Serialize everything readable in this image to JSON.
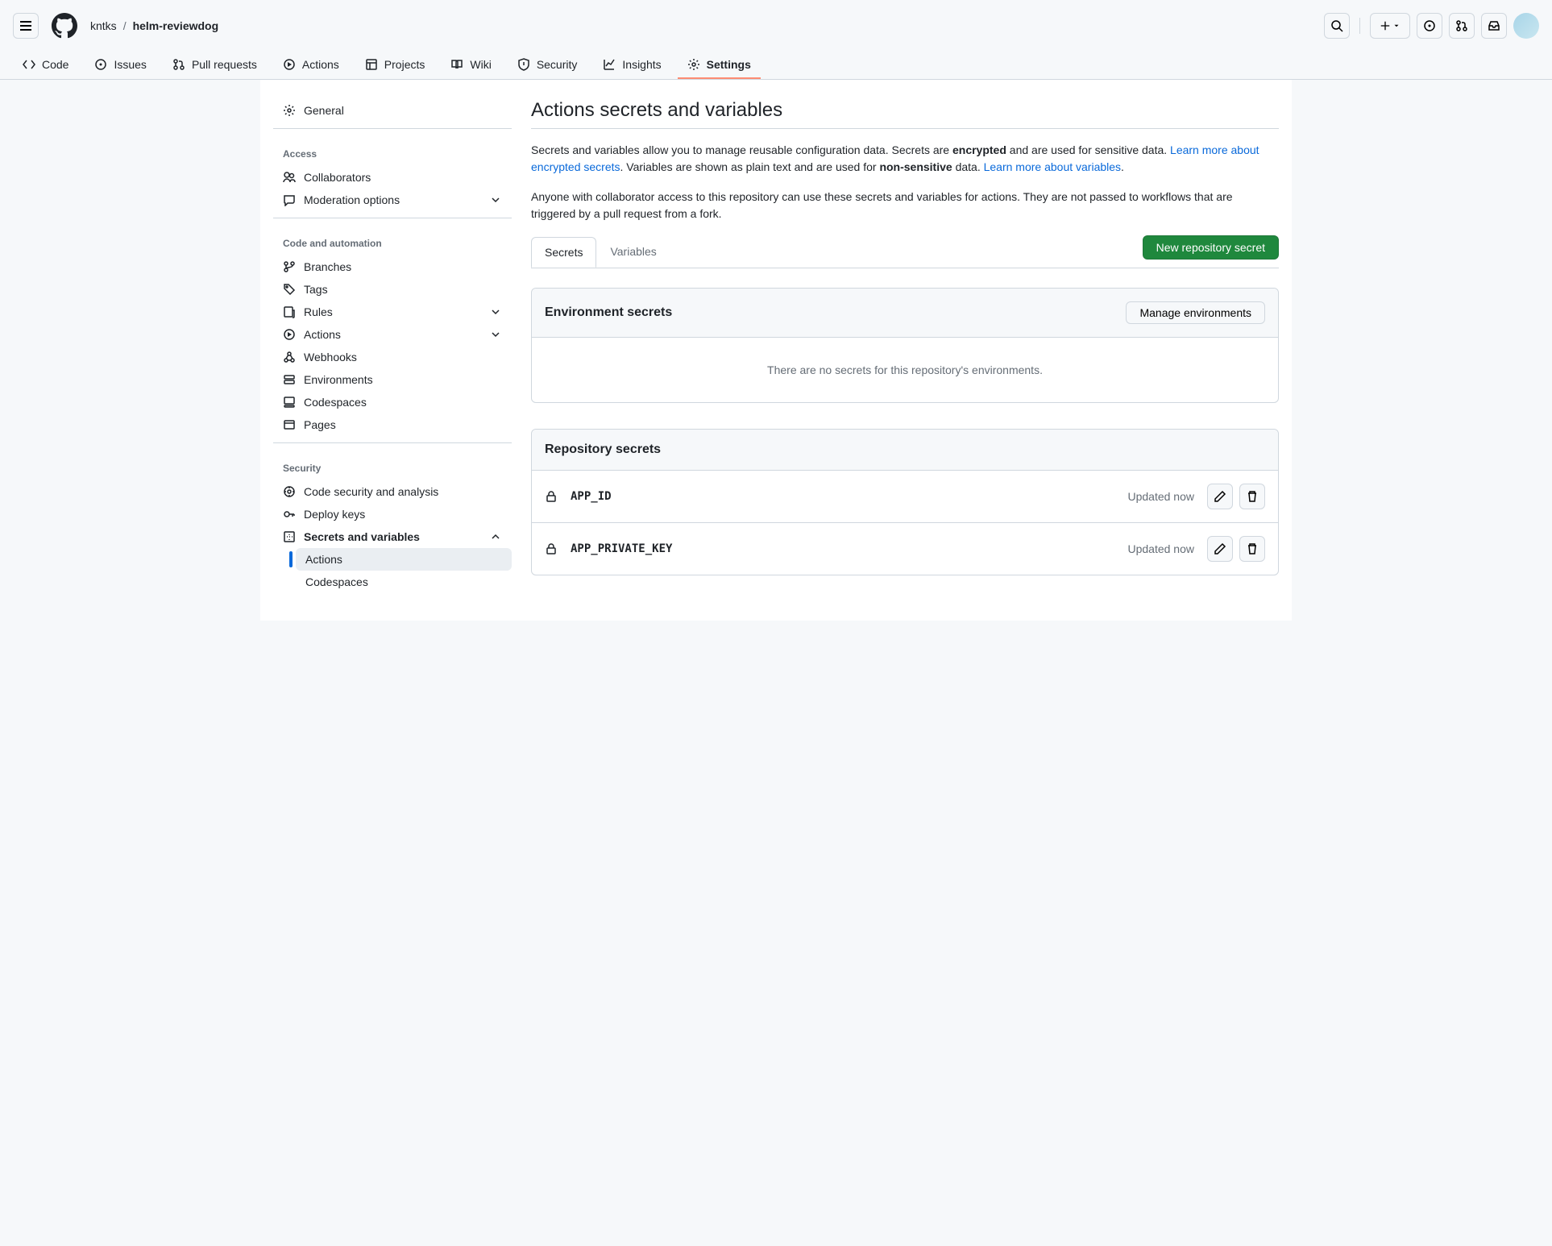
{
  "breadcrumb": {
    "owner": "kntks",
    "repo": "helm-reviewdog"
  },
  "repoNav": {
    "code": "Code",
    "issues": "Issues",
    "pulls": "Pull requests",
    "actions": "Actions",
    "projects": "Projects",
    "wiki": "Wiki",
    "security": "Security",
    "insights": "Insights",
    "settings": "Settings"
  },
  "sidebar": {
    "general": "General",
    "accessHeading": "Access",
    "collaborators": "Collaborators",
    "moderation": "Moderation options",
    "codeHeading": "Code and automation",
    "branches": "Branches",
    "tags": "Tags",
    "rules": "Rules",
    "actions": "Actions",
    "webhooks": "Webhooks",
    "environments": "Environments",
    "codespaces": "Codespaces",
    "pages": "Pages",
    "securityHeading": "Security",
    "codeSecurity": "Code security and analysis",
    "deployKeys": "Deploy keys",
    "secretsVars": "Secrets and variables",
    "secretsActions": "Actions",
    "secretsCodespaces": "Codespaces"
  },
  "page": {
    "title": "Actions secrets and variables",
    "desc1a": "Secrets and variables allow you to manage reusable configuration data. Secrets are ",
    "desc1b": "encrypted",
    "desc1c": " and are used for sensitive data. ",
    "learnSecrets": "Learn more about encrypted secrets",
    "desc1d": ". Variables are shown as plain text and are used for ",
    "desc1e": "non-sensitive",
    "desc1f": " data. ",
    "learnVars": "Learn more about variables",
    "desc1g": ".",
    "desc2": "Anyone with collaborator access to this repository can use these secrets and variables for actions. They are not passed to workflows that are triggered by a pull request from a fork.",
    "tabSecrets": "Secrets",
    "tabVariables": "Variables",
    "newSecret": "New repository secret",
    "envTitle": "Environment secrets",
    "manageEnv": "Manage environments",
    "envEmpty": "There are no secrets for this repository's environments.",
    "repoTitle": "Repository secrets",
    "secrets": [
      {
        "name": "APP_ID",
        "updated": "Updated now"
      },
      {
        "name": "APP_PRIVATE_KEY",
        "updated": "Updated now"
      }
    ]
  }
}
